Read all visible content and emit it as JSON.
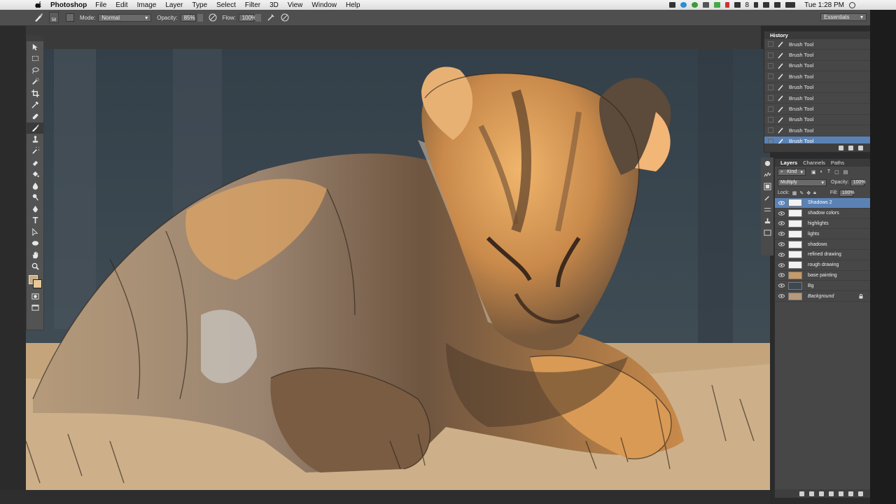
{
  "menubar": {
    "app_name": "Photoshop",
    "items": [
      "File",
      "Edit",
      "Image",
      "Layer",
      "Type",
      "Select",
      "Filter",
      "3D",
      "View",
      "Window",
      "Help"
    ],
    "status_extra": "8",
    "clock": "Tue 1:28 PM"
  },
  "options": {
    "brush_size": "58",
    "mode_label": "Mode:",
    "mode_value": "Normal",
    "opacity_label": "Opacity:",
    "opacity_value": "85%",
    "flow_label": "Flow:",
    "flow_value": "100%",
    "workspace": "Essentials"
  },
  "tools": [
    "move-tool-icon",
    "marquee-tool-icon",
    "lasso-tool-icon",
    "quick-select-tool-icon",
    "crop-tool-icon",
    "eyedropper-tool-icon",
    "healing-brush-tool-icon",
    "brush-tool-icon",
    "clone-stamp-tool-icon",
    "history-brush-tool-icon",
    "eraser-tool-icon",
    "paint-bucket-tool-icon",
    "blur-tool-icon",
    "dodge-tool-icon",
    "pen-tool-icon",
    "type-tool-icon",
    "path-select-tool-icon",
    "ellipse-tool-icon",
    "hand-tool-icon",
    "zoom-tool-icon"
  ],
  "history": {
    "title": "History",
    "items": [
      "Brush Tool",
      "Brush Tool",
      "Brush Tool",
      "Brush Tool",
      "Brush Tool",
      "Brush Tool",
      "Brush Tool",
      "Brush Tool",
      "Brush Tool",
      "Brush Tool"
    ],
    "selected_index": 9
  },
  "layers_panel": {
    "tabs": [
      "Layers",
      "Channels",
      "Paths"
    ],
    "filter_kind": "Kind",
    "blend_mode": "Multiply",
    "opacity_label": "Opacity:",
    "opacity_value": "100%",
    "lock_label": "Lock:",
    "fill_label": "Fill:",
    "fill_value": "100%",
    "layers": [
      "Shadows 2",
      "shadow colors",
      "highlights",
      "lights",
      "shadows",
      "refined drawing",
      "rough drawing",
      "base painting",
      "Bg",
      "Background"
    ],
    "selected_index": 0
  },
  "colors": {
    "accent_selection": "#5b82b5",
    "foreground": "#c8ad84",
    "background": "#e5c79a"
  }
}
